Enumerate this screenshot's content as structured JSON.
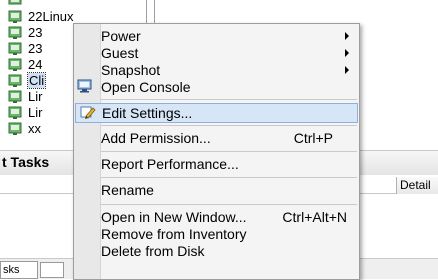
{
  "tree": {
    "items": [
      {
        "label": "22Linux",
        "selected": false
      },
      {
        "label": "23",
        "selected": false
      },
      {
        "label": "23",
        "selected": false
      },
      {
        "label": "24",
        "selected": false
      },
      {
        "label": "Cli",
        "selected": true
      },
      {
        "label": "Lir",
        "selected": false
      },
      {
        "label": "Lir",
        "selected": false
      },
      {
        "label": "xx",
        "selected": false
      }
    ]
  },
  "tasks": {
    "title": "t Tasks",
    "detail_col": "Detail",
    "status_tab": "sks"
  },
  "menu": {
    "power": "Power",
    "guest": "Guest",
    "snapshot": "Snapshot",
    "open_console": "Open Console",
    "edit_settings": "Edit Settings...",
    "add_permission": "Add Permission...",
    "add_permission_shortcut": "Ctrl+P",
    "report_performance": "Report Performance...",
    "rename": "Rename",
    "open_new_window": "Open in New Window...",
    "open_new_window_shortcut": "Ctrl+Alt+N",
    "remove_inventory": "Remove from Inventory",
    "delete_disk": "Delete from Disk"
  },
  "icons": {
    "vm": "vm-icon",
    "console": "console-icon",
    "edit": "edit-settings-icon"
  },
  "colors": {
    "highlight": "#d7e6f7",
    "highlight_border": "#8fb0d8",
    "vm_icon_green": "#3c9a3c"
  }
}
